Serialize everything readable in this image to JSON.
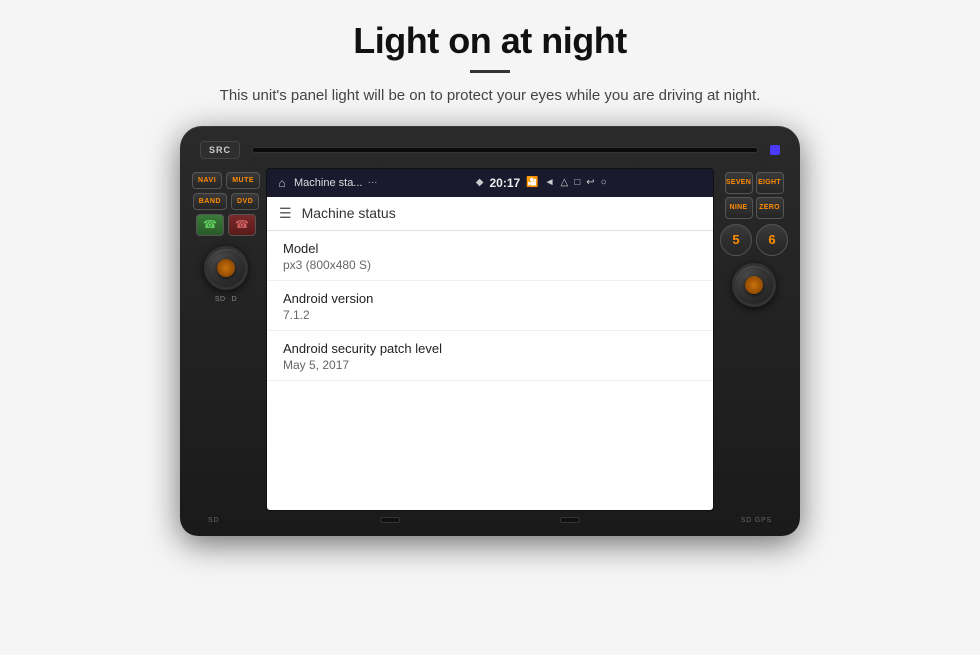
{
  "page": {
    "title": "Light on at night",
    "divider": true,
    "subtitle": "This unit's panel light will be on to protect your eyes while you are driving at night."
  },
  "unit": {
    "top_btn": "SRC",
    "status_bar": {
      "app_name": "Machine sta...",
      "dots": "···",
      "nav_icon": "◆",
      "time": "20:17",
      "icons": [
        "📷",
        "◄",
        "△",
        "□",
        "↩",
        "↺"
      ]
    },
    "app": {
      "header_title": "Machine status",
      "items": [
        {
          "label": "Model",
          "value": "px3 (800x480 S)"
        },
        {
          "label": "Android version",
          "value": "7.1.2"
        },
        {
          "label": "Android security patch level",
          "value": "May 5, 2017"
        }
      ]
    },
    "left_buttons": [
      "NAVI",
      "MUTE",
      "BAND",
      "DVD"
    ],
    "right_buttons": [
      "SEVEN",
      "EIGHT",
      "NINE",
      "ZERO"
    ],
    "bottom_left": "SD",
    "bottom_right": "SD GPS"
  }
}
